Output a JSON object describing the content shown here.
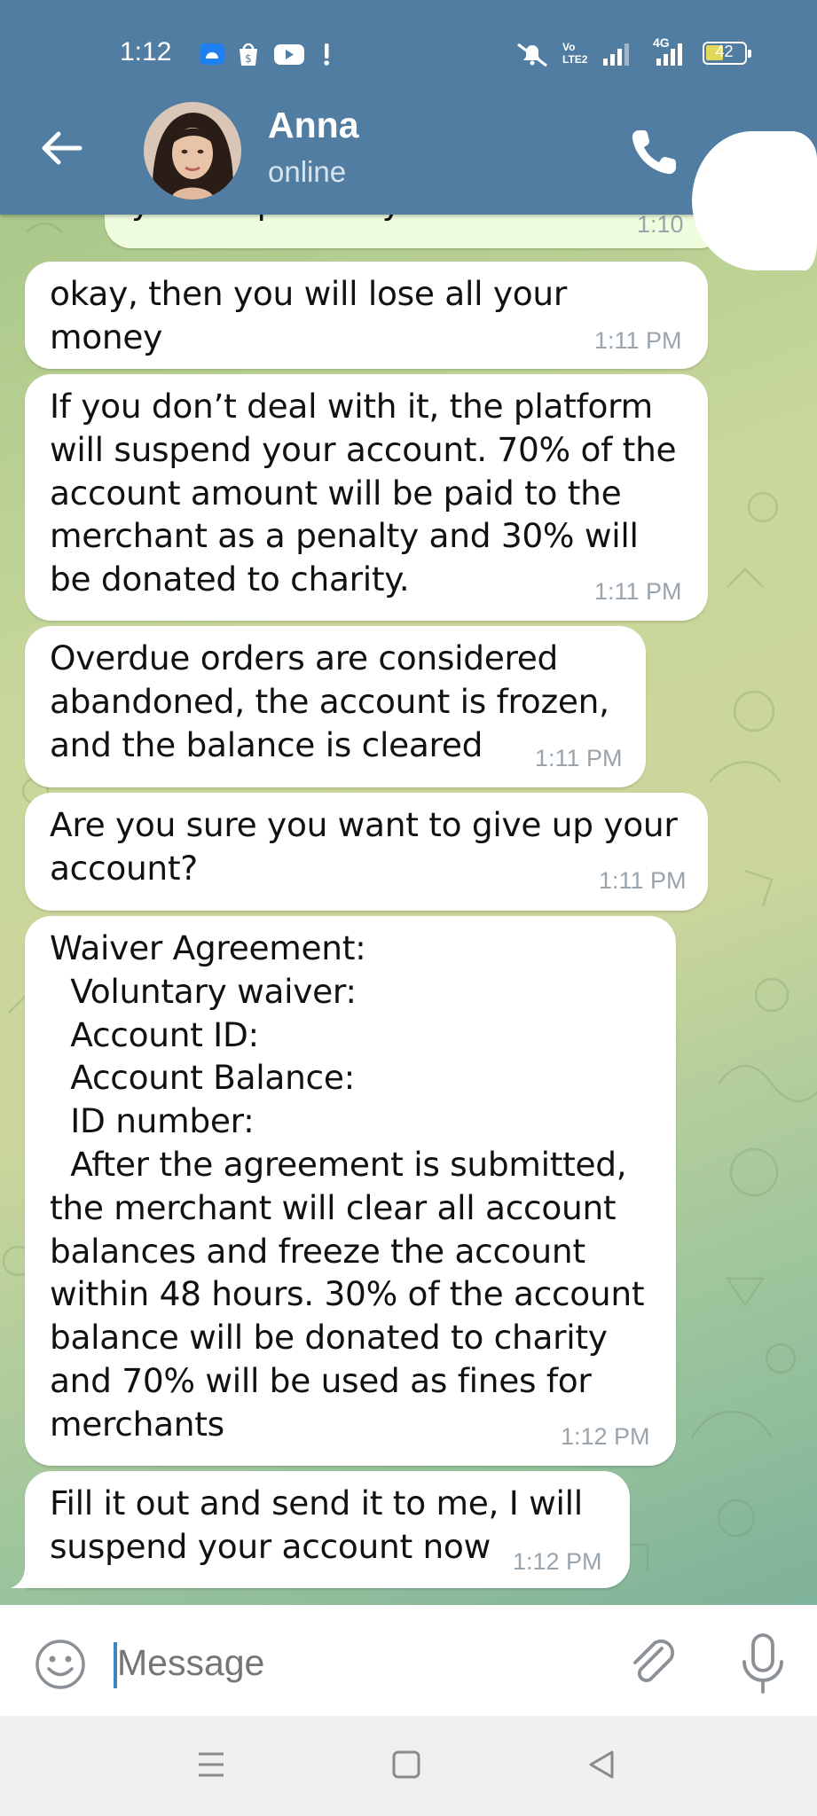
{
  "status_bar": {
    "time": "1:12",
    "network": "4G",
    "volte": "Vo LTE2",
    "battery": "42"
  },
  "header": {
    "contact_name": "Anna",
    "contact_status": "online"
  },
  "messages": [
    {
      "text": "you suspend my account",
      "time": "1:10",
      "outgoing": true
    },
    {
      "text": "okay, then you will lose all your money",
      "time": "1:11 PM",
      "outgoing": false
    },
    {
      "text": "If you don’t deal with it, the platform\nwill suspend your account. 70% of the\naccount amount will be paid to the\nmerchant as a penalty and 30% will\nbe donated to charity.",
      "time": "1:11 PM",
      "outgoing": false
    },
    {
      "text": "Overdue orders are considered\nabandoned, the account is frozen,\nand the balance is cleared",
      "time": "1:11 PM",
      "outgoing": false
    },
    {
      "text": "Are you sure you want to give up your\naccount?",
      "time": "1:11 PM",
      "outgoing": false
    },
    {
      "text": "Waiver Agreement:\n  Voluntary waiver:\n  Account ID:\n  Account Balance:\n  ID number:\n  After the agreement is submitted,\nthe merchant will clear all account\nbalances and freeze the account\nwithin 48 hours. 30% of the account\nbalance will be donated to charity\nand 70% will be used as fines for\nmerchants",
      "time": "1:12 PM",
      "outgoing": false
    },
    {
      "text": "Fill it out and send it to me, I will\nsuspend your account now",
      "time": "1:12 PM",
      "outgoing": false
    }
  ],
  "input": {
    "placeholder": "Message"
  },
  "colors": {
    "header": "#517da2",
    "bubble_in": "#ffffff",
    "bubble_out": "#effdde",
    "time_text": "#9aa4ad"
  },
  "icons": [
    "back-arrow-icon",
    "phone-icon",
    "emoji-icon",
    "attach-icon",
    "mic-icon",
    "menu-icon",
    "home-icon",
    "back-nav-icon"
  ]
}
